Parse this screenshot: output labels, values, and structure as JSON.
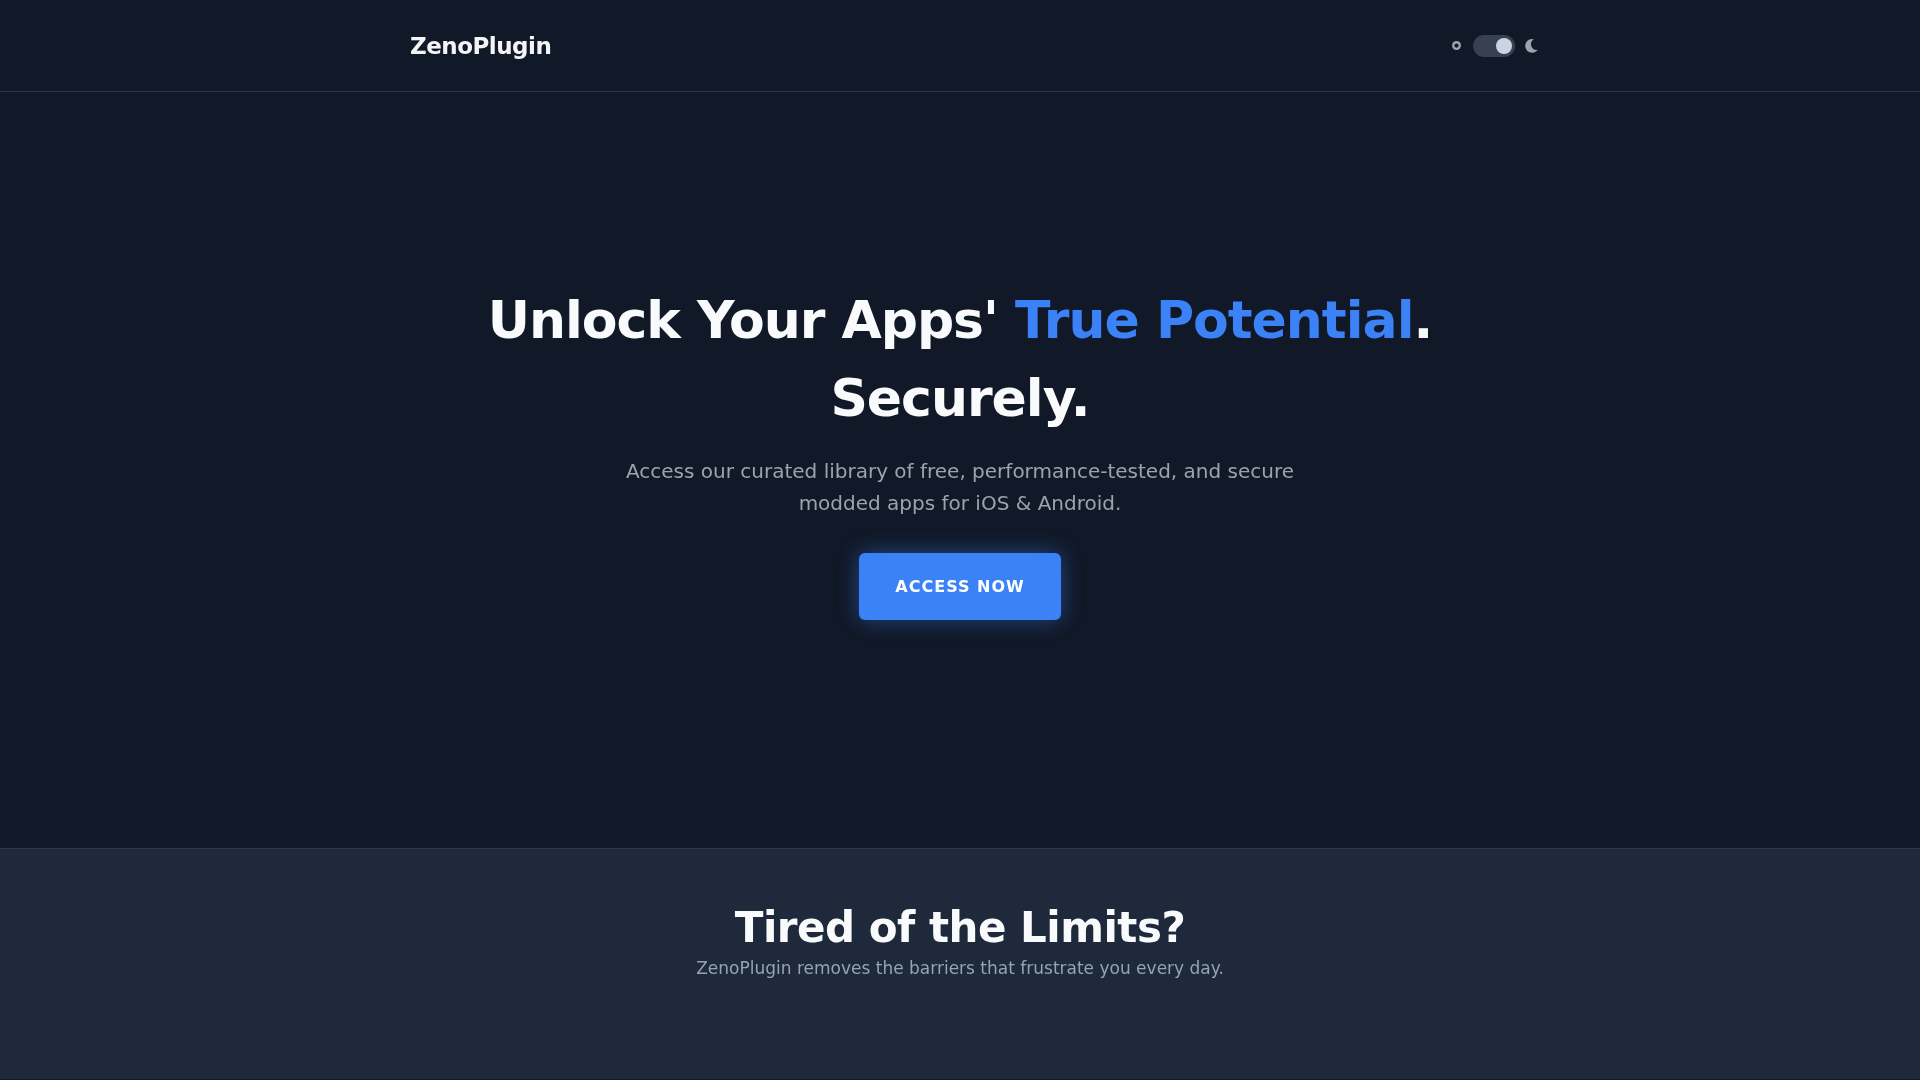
{
  "header": {
    "logo": "ZenoPlugin",
    "theme_toggle": {
      "on": true
    }
  },
  "hero": {
    "title_line_1": [
      {
        "text": "Unlock Your Apps' ",
        "highlight": false
      },
      {
        "text": "True Potential",
        "highlight": true
      },
      {
        "text": ".",
        "highlight": false
      }
    ],
    "title_line_2": "Securely.",
    "subtitle": "Access our curated library of free, performance-tested, and secure modded apps for iOS & Android.",
    "button": "ACCESS NOW"
  },
  "limits_section": {
    "title": "Tired of the Limits?",
    "subtitle": "ZenoPlugin removes the barriers that frustrate you every day."
  }
}
